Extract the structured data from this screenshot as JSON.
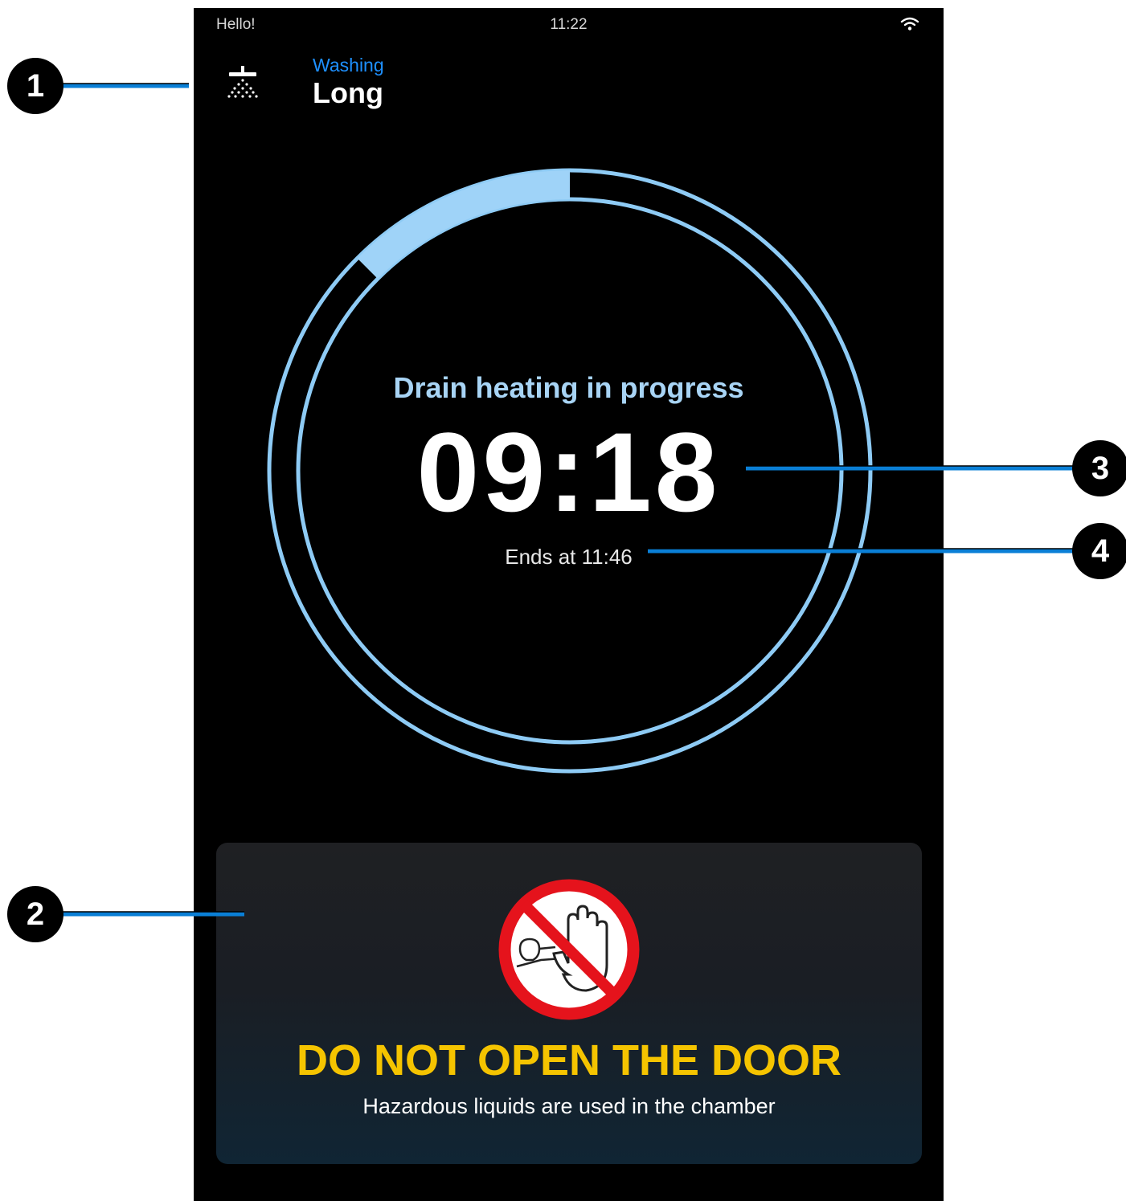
{
  "status_bar": {
    "greeting": "Hello!",
    "time": "11:22",
    "wifi_icon": "wifi-icon"
  },
  "program": {
    "icon": "shower-icon",
    "type_label": "Washing",
    "name": "Long"
  },
  "timer": {
    "phase_label": "Drain heating in progress",
    "remaining": "09:18",
    "end_time": "Ends at 11:46",
    "progress_fraction": 0.125,
    "ring_color": "#8ecbf5",
    "progress_color": "#9fd3f8"
  },
  "warning": {
    "icon": "no-entry-hand-icon",
    "title": "DO NOT OPEN THE DOOR",
    "subtitle": "Hazardous liquids are used in the chamber",
    "title_color": "#f5c400",
    "sign_color": "#e5131c"
  },
  "callouts": {
    "c1": "1",
    "c2": "2",
    "c3": "3",
    "c4": "4",
    "line_color": "#0a7fd6"
  }
}
